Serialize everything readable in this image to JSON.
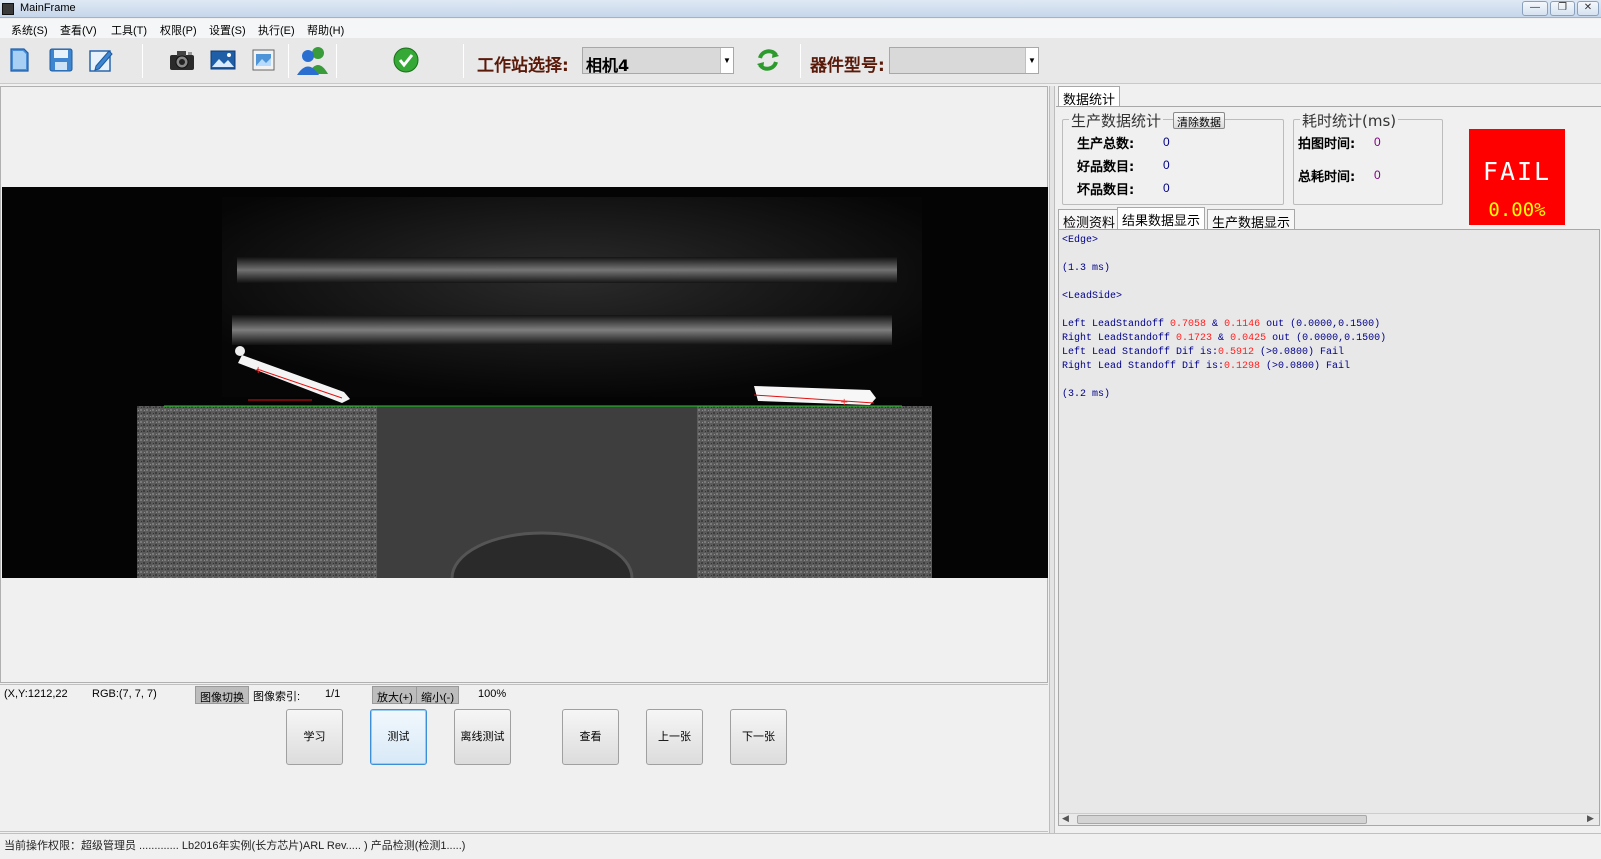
{
  "window": {
    "title": "MainFrame",
    "minimize": "—",
    "maximize": "❐",
    "close": "✕"
  },
  "menu": [
    "系统(S)",
    "查看(V)",
    "工具(T)",
    "权限(P)",
    "设置(S)",
    "执行(E)",
    "帮助(H)"
  ],
  "toolbar": {
    "station_label": "工作站选择:",
    "station_value": "相机4",
    "part_label": "器件型号:",
    "part_value": "",
    "icons": [
      "new-file-icon",
      "save-icon",
      "edit-icon",
      "camera-icon",
      "image-icon",
      "open-image-icon",
      "users-icon",
      "check-icon",
      "refresh-icon"
    ]
  },
  "image_status": {
    "coords": "(X,Y:1212,22",
    "rgb": "RGB:(7, 7, 7)",
    "switch_btn": "图像切换",
    "index_label": "图像索引:",
    "index_value": "1/1",
    "zoom_in": "放大(+)",
    "zoom_out": "缩小(-)",
    "zoom_value": "100%"
  },
  "actions": [
    "学习",
    "测试",
    "离线测试",
    "查看",
    "上一张",
    "下一张"
  ],
  "status_message": "当前操作权限：超级管理员 ............. Lb2016年实例(长方芯片)ARL Rev..... ) 产品检测(检测1.....)",
  "right": {
    "top_tab": "数据统计",
    "production": {
      "title": "生产数据统计",
      "clear_btn": "清除数据",
      "total_label": "生产总数:",
      "total": "0",
      "good_label": "好品数目:",
      "good": "0",
      "bad_label": "坏品数目:",
      "bad": "0"
    },
    "timing": {
      "title": "耗时统计(ms)",
      "capture_label": "拍图时间:",
      "capture": "0",
      "total_label": "总耗时间:",
      "total": "0"
    },
    "result_box": {
      "status": "FAIL",
      "percent": "0.00%",
      "color": "#ff0000"
    },
    "tabs": [
      "检测资料",
      "结果数据显示",
      "生产数据显示"
    ],
    "selected_tab": "结果数据显示",
    "results": {
      "l1": "<Edge>",
      "l2": "(1.3 ms)",
      "l3": "<LeadSide>",
      "l4a": "Left LeadStandoff ",
      "l4b": "0.7058",
      "l4c": " & ",
      "l4d": "0.1146",
      "l4e": " out (0.0000,0.1500)",
      "l5a": "Right LeadStandoff ",
      "l5b": "0.1723",
      "l5c": " & ",
      "l5d": "0.0425",
      "l5e": " out (0.0000,0.1500)",
      "l6a": "Left Lead Standoff Dif is:",
      "l6b": "0.5912",
      "l6c": " (>0.0800) Fail",
      "l7a": "Right Lead Standoff Dif is:",
      "l7b": "0.1298",
      "l7c": " (>0.0800) Fail",
      "l8": "(3.2 ms)"
    }
  }
}
